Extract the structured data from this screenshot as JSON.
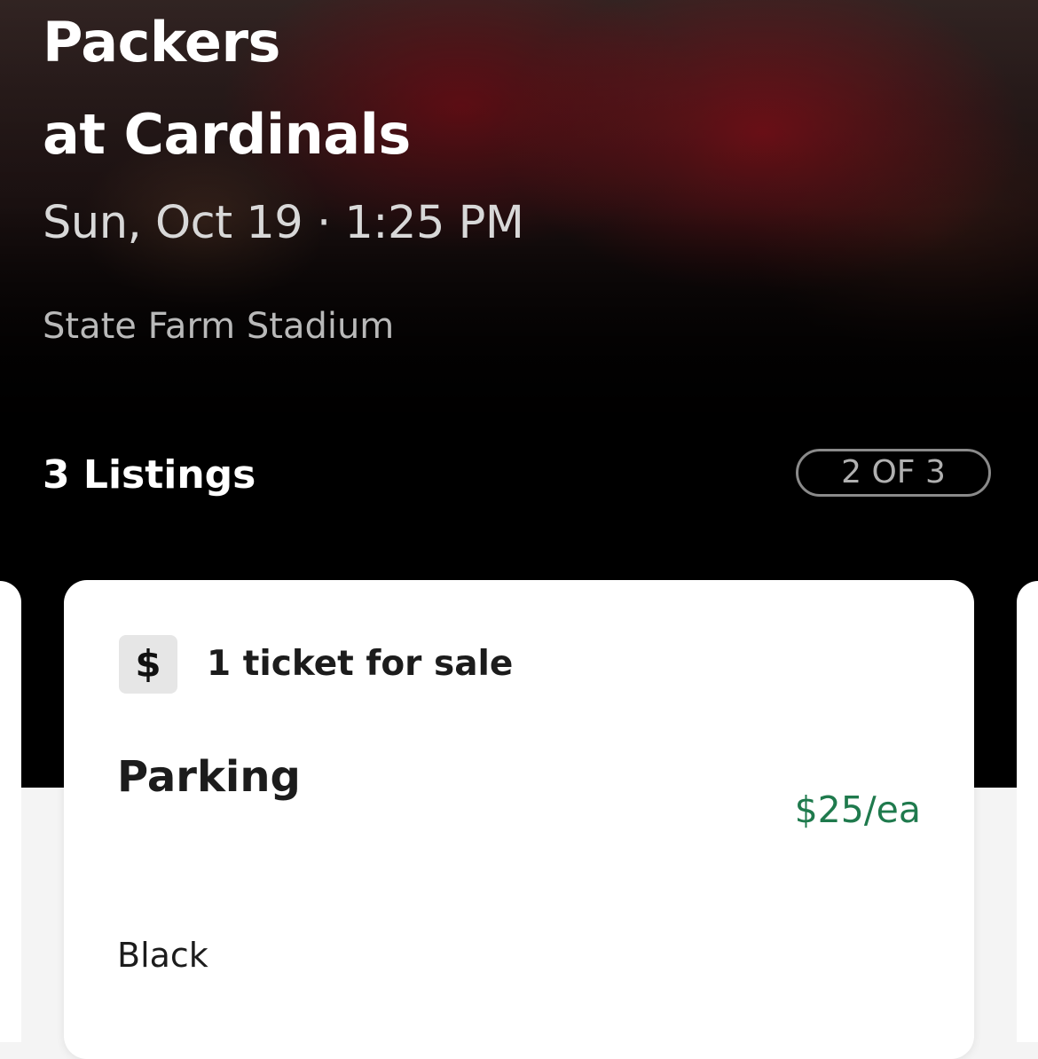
{
  "event": {
    "title_line1": "Packers",
    "title_line2": "at Cardinals",
    "datetime": "Sun, Oct 19 · 1:25 PM",
    "venue": "State Farm Stadium"
  },
  "listings": {
    "count_label": "3 Listings",
    "pager_label": "2 OF 3",
    "current": 2,
    "total": 3
  },
  "listing_card": {
    "badge_icon": "dollar-icon",
    "badge_symbol": "$",
    "sale_text": "1 ticket for sale",
    "section": "Parking",
    "price": "$25/ea",
    "detail": "Black"
  },
  "colors": {
    "price": "#1f7a4d",
    "hero_background": "#000000",
    "page_background": "#f4f4f4"
  }
}
